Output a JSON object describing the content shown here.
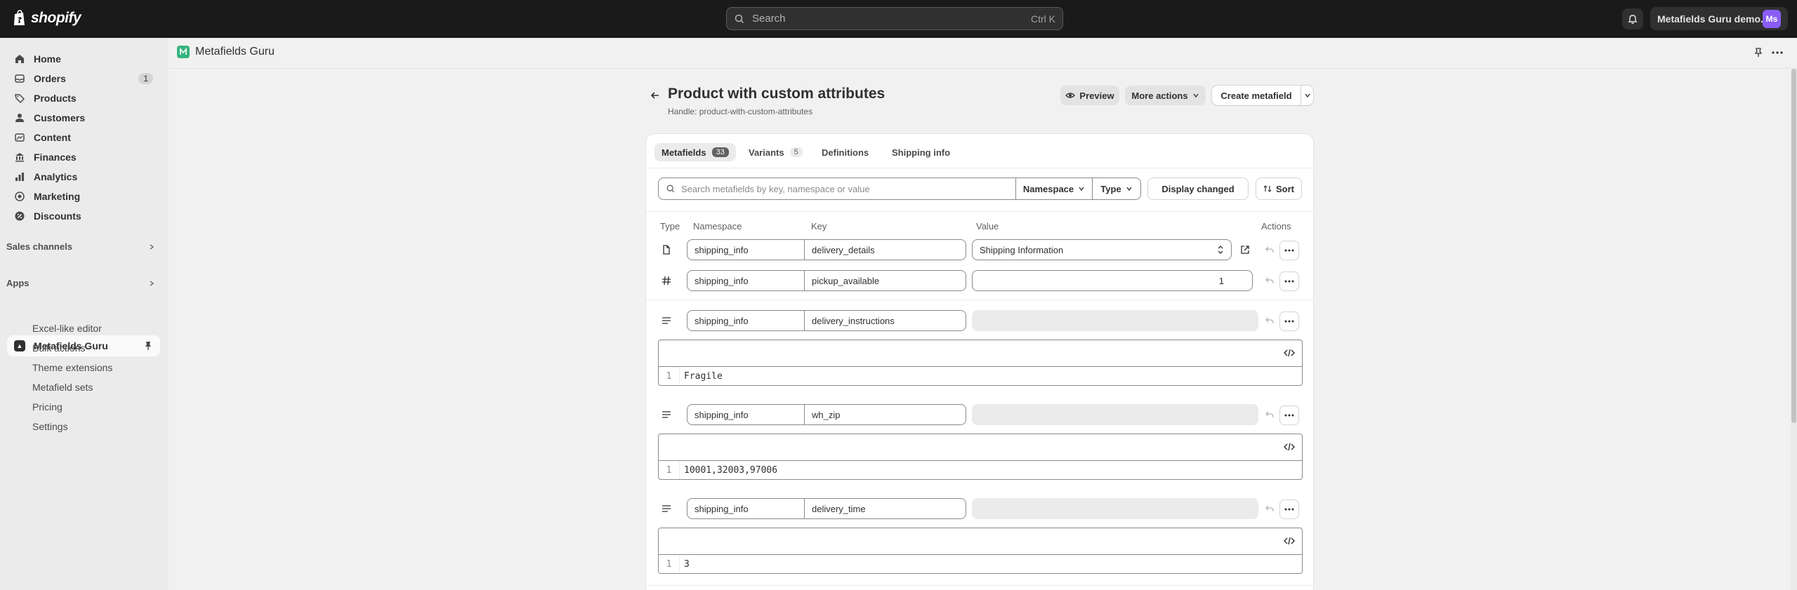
{
  "topbar": {
    "brand": "shopify",
    "search_placeholder": "Search",
    "search_shortcut": "Ctrl K",
    "store_name": "Metafields Guru demo...",
    "avatar_initials": "Ms"
  },
  "sidebar": {
    "nav": [
      {
        "label": "Home",
        "icon": "home-icon"
      },
      {
        "label": "Orders",
        "icon": "orders-icon",
        "count": "1"
      },
      {
        "label": "Products",
        "icon": "products-icon"
      },
      {
        "label": "Customers",
        "icon": "customers-icon"
      },
      {
        "label": "Content",
        "icon": "content-icon"
      },
      {
        "label": "Finances",
        "icon": "finances-icon"
      },
      {
        "label": "Analytics",
        "icon": "analytics-icon"
      },
      {
        "label": "Marketing",
        "icon": "marketing-icon"
      },
      {
        "label": "Discounts",
        "icon": "discounts-icon"
      }
    ],
    "sales_channels": "Sales channels",
    "apps": "Apps",
    "app_name": "Metafields Guru",
    "app_sub": [
      "Excel-like editor",
      "Bulk actions",
      "Theme extensions",
      "Metafield sets",
      "Pricing",
      "Settings"
    ]
  },
  "appbar": {
    "title": "Metafields Guru"
  },
  "page": {
    "title": "Product with custom attributes",
    "handle": "Handle: product-with-custom-attributes",
    "preview": "Preview",
    "more_actions": "More actions",
    "create": "Create metafield"
  },
  "tabs": [
    {
      "label": "Metafields",
      "count": "33"
    },
    {
      "label": "Variants",
      "count": "5"
    },
    {
      "label": "Definitions"
    },
    {
      "label": "Shipping info"
    }
  ],
  "filters": {
    "search_placeholder": "Search metafields by key, namespace or value",
    "namespace": "Namespace",
    "type": "Type",
    "display_changed": "Display changed",
    "sort": "Sort"
  },
  "columns": {
    "type": "Type",
    "namespace": "Namespace",
    "key": "Key",
    "value": "Value",
    "actions": "Actions"
  },
  "rows": [
    {
      "namespace": "shipping_info",
      "key": "delivery_details",
      "value": "Shipping Information"
    },
    {
      "namespace": "shipping_info",
      "key": "pickup_available",
      "value": "1"
    },
    {
      "namespace": "shipping_info",
      "key": "delivery_instructions",
      "line_num": "1",
      "code": "Fragile"
    },
    {
      "namespace": "shipping_info",
      "key": "wh_zip",
      "line_num": "1",
      "code": "10001,32003,97006"
    },
    {
      "namespace": "shipping_info",
      "key": "delivery_time",
      "line_num": "1",
      "code": "3"
    }
  ]
}
